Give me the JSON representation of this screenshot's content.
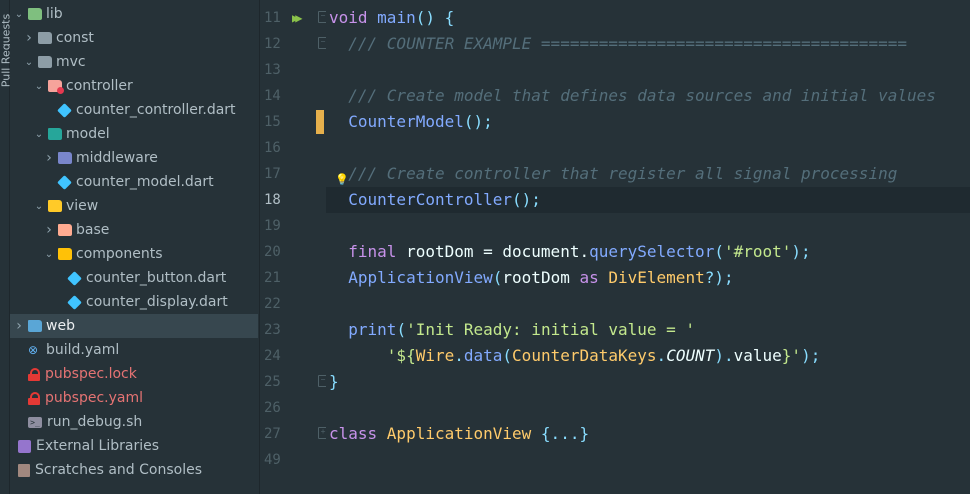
{
  "side_strip": {
    "label": "Pull Requests"
  },
  "tree": {
    "rows": [
      {
        "label": "lib",
        "depth": 0,
        "expanded": true,
        "icon": "folder-green-icon"
      },
      {
        "label": "const",
        "depth": 1,
        "expanded": false,
        "icon": "folder-gray-icon"
      },
      {
        "label": "mvc",
        "depth": 1,
        "expanded": true,
        "icon": "folder-gray-icon"
      },
      {
        "label": "controller",
        "depth": 2,
        "expanded": true,
        "icon": "folder-controller-icon"
      },
      {
        "label": "counter_controller.dart",
        "depth": 3,
        "icon": "dart-file-icon"
      },
      {
        "label": "model",
        "depth": 2,
        "expanded": true,
        "icon": "folder-model-icon"
      },
      {
        "label": "middleware",
        "depth": 3,
        "expanded": false,
        "icon": "folder-middleware-icon"
      },
      {
        "label": "counter_model.dart",
        "depth": 3,
        "icon": "dart-file-icon"
      },
      {
        "label": "view",
        "depth": 2,
        "expanded": true,
        "icon": "folder-view-icon"
      },
      {
        "label": "base",
        "depth": 3,
        "expanded": false,
        "icon": "folder-base-icon"
      },
      {
        "label": "components",
        "depth": 3,
        "expanded": true,
        "icon": "folder-components-icon"
      },
      {
        "label": "counter_button.dart",
        "depth": 4,
        "icon": "dart-file-icon"
      },
      {
        "label": "counter_display.dart",
        "depth": 4,
        "icon": "dart-file-icon"
      },
      {
        "label": "web",
        "depth": 0,
        "expanded": false,
        "icon": "folder-web-icon",
        "selected": true
      },
      {
        "label": "build.yaml",
        "depth": 0,
        "icon": "yaml-file-icon"
      },
      {
        "label": "pubspec.lock",
        "depth": 0,
        "icon": "lock-file-icon",
        "red": true
      },
      {
        "label": "pubspec.yaml",
        "depth": 0,
        "icon": "lock-file-icon"
      },
      {
        "label": "run_debug.sh",
        "depth": 0,
        "icon": "shell-file-icon"
      },
      {
        "label": "External Libraries",
        "depth": -1,
        "icon": "libraries-icon"
      },
      {
        "label": "Scratches and Consoles",
        "depth": -1,
        "icon": "scratches-icon"
      }
    ]
  },
  "editor": {
    "current_line": "18",
    "lines": [
      {
        "num": "11",
        "tokens": [
          [
            "kw",
            "void "
          ],
          [
            "fn",
            "main"
          ],
          [
            "punc",
            "() {"
          ]
        ]
      },
      {
        "num": "12",
        "tokens": [
          [
            "plain",
            "  "
          ],
          [
            "cmt",
            "/// COUNTER EXAMPLE ======================================"
          ]
        ]
      },
      {
        "num": "13",
        "tokens": []
      },
      {
        "num": "14",
        "tokens": [
          [
            "plain",
            "  "
          ],
          [
            "cmt",
            "/// Create model that defines data sources and initial values"
          ]
        ]
      },
      {
        "num": "15",
        "tokens": [
          [
            "plain",
            "  "
          ],
          [
            "fn",
            "CounterModel"
          ],
          [
            "punc",
            "();"
          ]
        ]
      },
      {
        "num": "16",
        "tokens": []
      },
      {
        "num": "17",
        "tokens": [
          [
            "plain",
            "  "
          ],
          [
            "cmt",
            "/// Create controller that register all signal processing"
          ]
        ]
      },
      {
        "num": "18",
        "tokens": [
          [
            "plain",
            "  "
          ],
          [
            "fn",
            "CounterController"
          ],
          [
            "punc",
            "();"
          ]
        ]
      },
      {
        "num": "19",
        "tokens": []
      },
      {
        "num": "20",
        "tokens": [
          [
            "plain",
            "  "
          ],
          [
            "kw",
            "final "
          ],
          [
            "plain",
            "rootDom = document."
          ],
          [
            "fn",
            "querySelector"
          ],
          [
            "punc",
            "("
          ],
          [
            "str",
            "'#root'"
          ],
          [
            "punc",
            ");"
          ]
        ]
      },
      {
        "num": "21",
        "tokens": [
          [
            "plain",
            "  "
          ],
          [
            "fn",
            "ApplicationView"
          ],
          [
            "punc",
            "("
          ],
          [
            "plain",
            "rootDom "
          ],
          [
            "kw",
            "as "
          ],
          [
            "cls",
            "DivElement"
          ],
          [
            "punc",
            "?);"
          ]
        ]
      },
      {
        "num": "22",
        "tokens": []
      },
      {
        "num": "23",
        "tokens": [
          [
            "plain",
            "  "
          ],
          [
            "fn",
            "print"
          ],
          [
            "punc",
            "("
          ],
          [
            "str",
            "'Init Ready: initial value = '"
          ]
        ]
      },
      {
        "num": "24",
        "tokens": [
          [
            "plain",
            "      "
          ],
          [
            "str",
            "'${"
          ],
          [
            "cls",
            "Wire"
          ],
          [
            "punc",
            "."
          ],
          [
            "fn",
            "data"
          ],
          [
            "punc",
            "("
          ],
          [
            "cls",
            "CounterDataKeys"
          ],
          [
            "punc",
            "."
          ],
          [
            "cmt",
            "COUNT"
          ],
          [
            "punc",
            ")."
          ],
          [
            "plain",
            "value"
          ],
          [
            "str",
            "}'"
          ],
          [
            "punc",
            ");"
          ]
        ]
      },
      {
        "num": "25",
        "tokens": [
          [
            "punc",
            "}"
          ]
        ]
      },
      {
        "num": "26",
        "tokens": []
      },
      {
        "num": "27",
        "tokens": [
          [
            "kw",
            "class "
          ],
          [
            "cls",
            "ApplicationView "
          ],
          [
            "punc",
            "{...}"
          ]
        ]
      },
      {
        "num": "49",
        "tokens": []
      }
    ]
  }
}
